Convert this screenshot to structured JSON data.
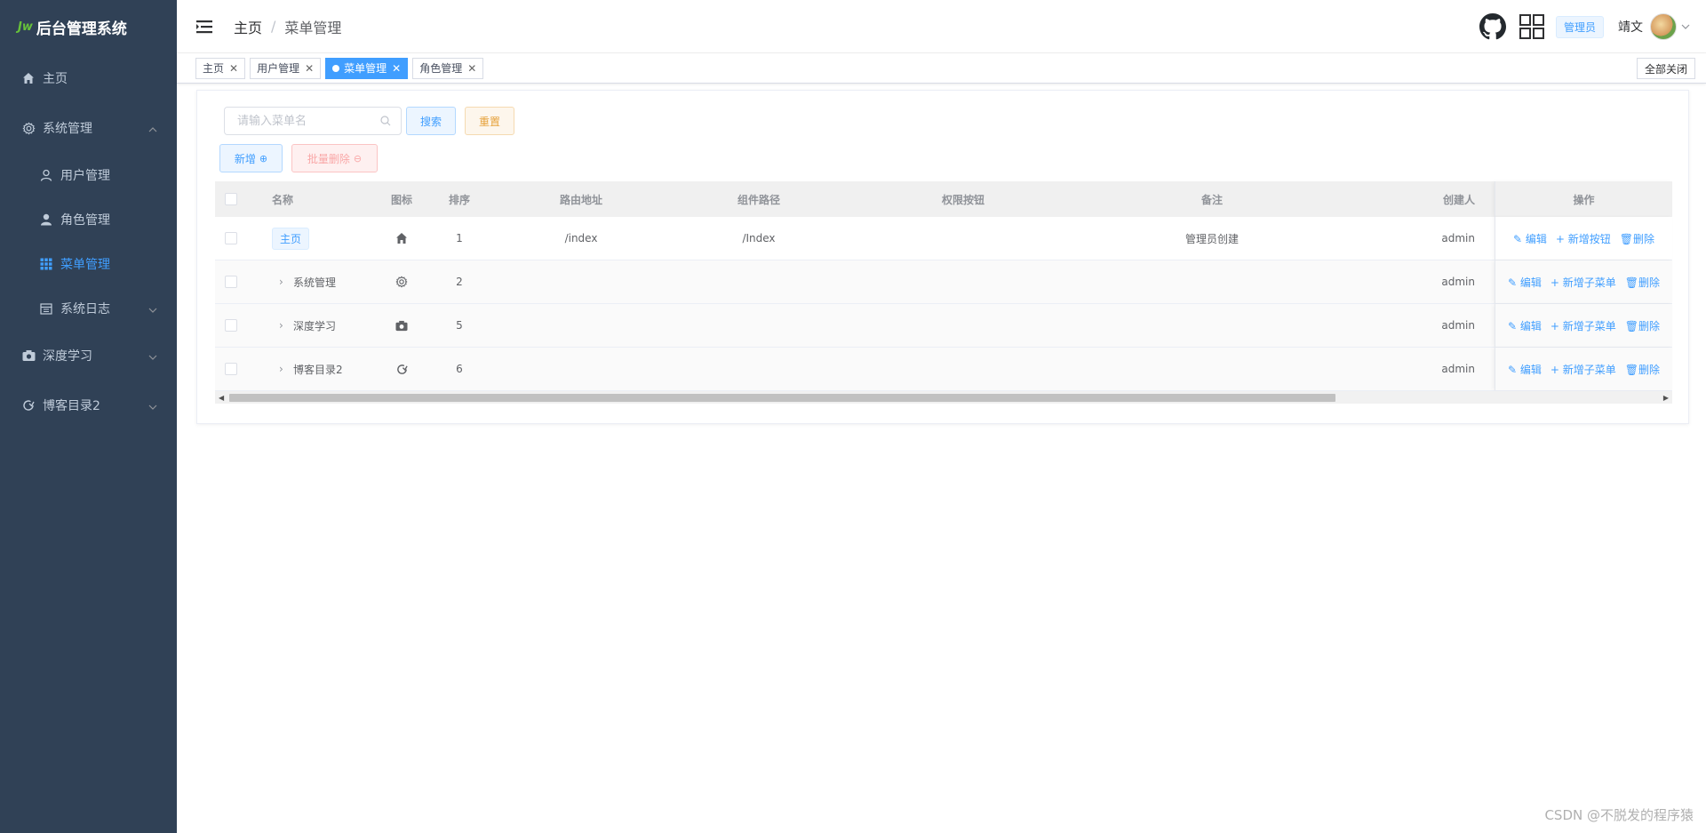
{
  "app": {
    "title": "后台管理系统",
    "logo_mark": "Jw"
  },
  "sidebar": {
    "items": [
      {
        "label": "主页",
        "icon": "home-icon"
      },
      {
        "label": "系统管理",
        "icon": "gear-icon",
        "expanded": true
      },
      {
        "label": "用户管理",
        "icon": "user-icon"
      },
      {
        "label": "角色管理",
        "icon": "user-solid-icon"
      },
      {
        "label": "菜单管理",
        "icon": "grid-icon",
        "active": true
      },
      {
        "label": "系统日志",
        "icon": "calendar-icon"
      },
      {
        "label": "深度学习",
        "icon": "camera-icon"
      },
      {
        "label": "博客目录2",
        "icon": "refresh-icon"
      }
    ],
    "active_color": "#409eff",
    "bg_color": "#304156"
  },
  "header": {
    "breadcrumb_home": "主页",
    "breadcrumb_sep": "/",
    "breadcrumb_current": "菜单管理",
    "role": "管理员",
    "username": "靖文"
  },
  "tags": {
    "items": [
      {
        "label": "主页"
      },
      {
        "label": "用户管理"
      },
      {
        "label": "菜单管理",
        "active": true
      },
      {
        "label": "角色管理"
      }
    ],
    "close_all": "全部关闭"
  },
  "toolbar": {
    "search_placeholder": "请输入菜单名",
    "search_label": "搜索",
    "reset_label": "重置",
    "add_label": "新增",
    "batch_delete_label": "批量删除"
  },
  "table": {
    "headers": {
      "name": "名称",
      "icon": "图标",
      "sort": "排序",
      "path": "路由地址",
      "component": "组件路径",
      "perm": "权限按钮",
      "note": "备注",
      "creator": "创建人",
      "op": "操作"
    },
    "rows": [
      {
        "name": "主页",
        "icon": "home-icon",
        "sort": "1",
        "path": "/index",
        "component": "/Index",
        "note": "管理员创建",
        "creator": "admin",
        "ops": [
          "编辑",
          "新增按钮",
          "删除"
        ]
      },
      {
        "name": "系统管理",
        "icon": "gear-icon",
        "sort": "2",
        "path": "",
        "component": "",
        "note": "",
        "creator": "admin",
        "ops": [
          "编辑",
          "新增子菜单",
          "删除"
        ]
      },
      {
        "name": "深度学习",
        "icon": "camera-icon",
        "sort": "5",
        "path": "",
        "component": "",
        "note": "",
        "creator": "admin",
        "ops": [
          "编辑",
          "新增子菜单",
          "删除"
        ]
      },
      {
        "name": "博客目录2",
        "icon": "refresh-icon",
        "sort": "6",
        "path": "",
        "component": "",
        "note": "",
        "creator": "admin",
        "ops": [
          "编辑",
          "新增子菜单",
          "删除"
        ]
      }
    ]
  },
  "watermark": "CSDN @不脱发的程序猿"
}
